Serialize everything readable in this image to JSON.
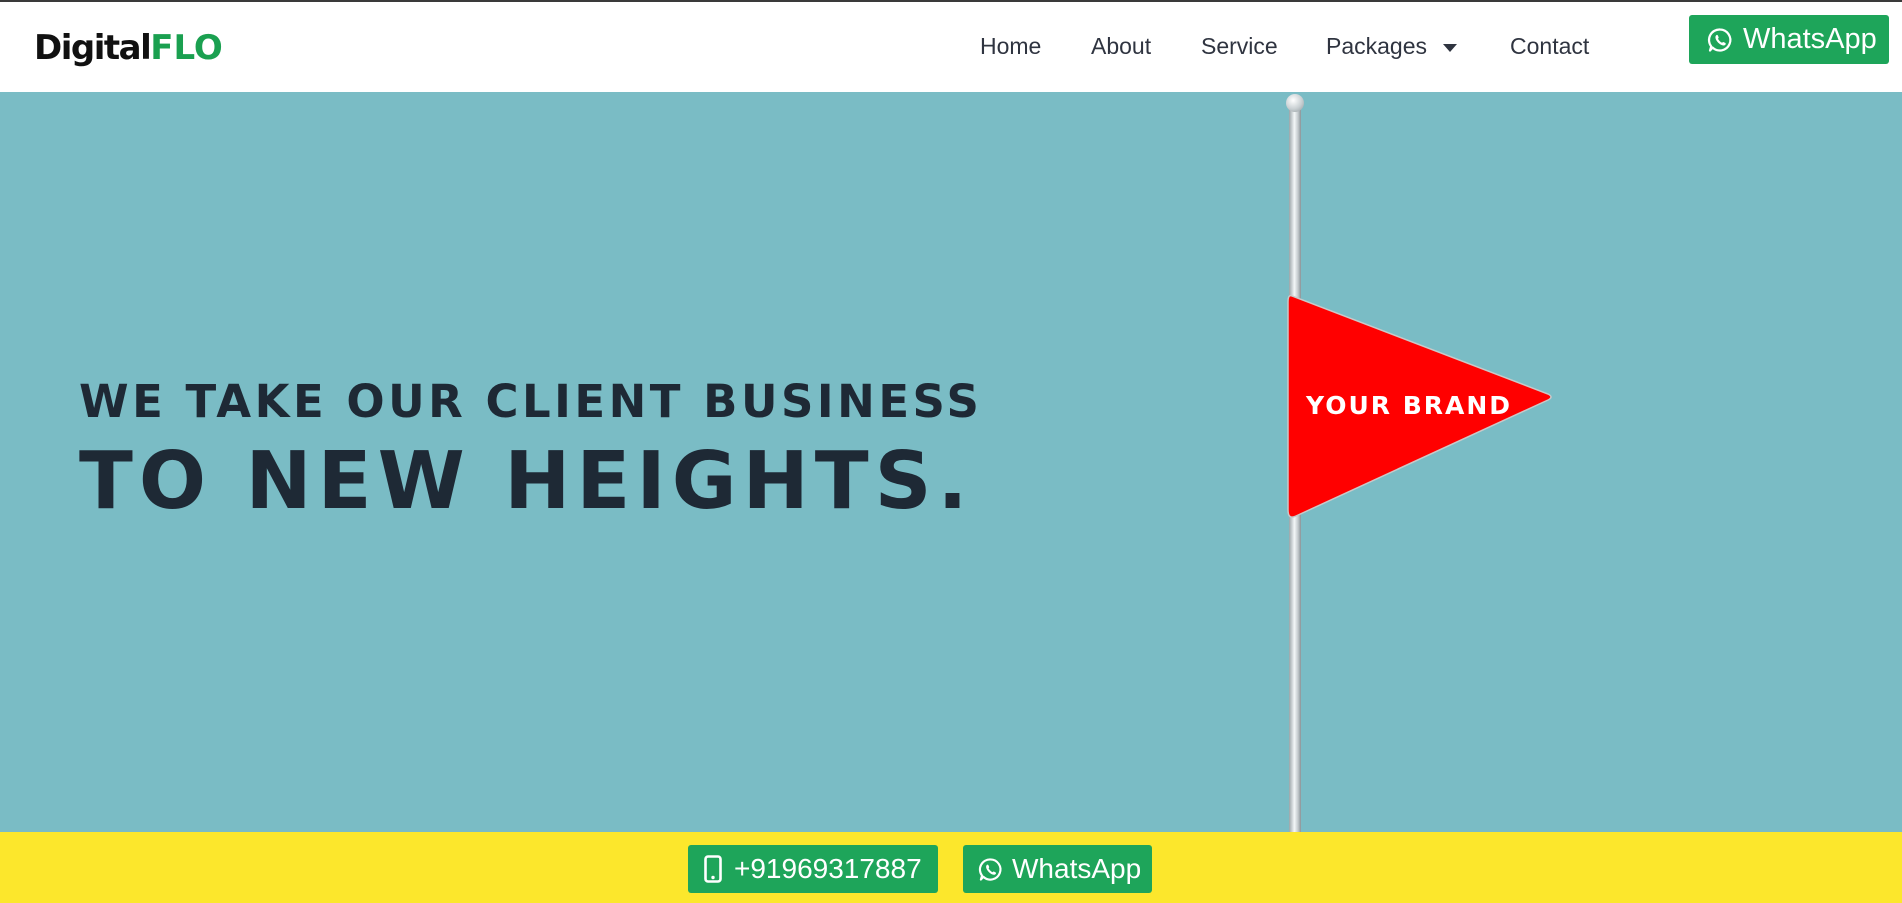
{
  "header": {
    "logo": {
      "part1": "Digital",
      "part2": "FLO"
    },
    "nav": [
      {
        "label": "Home"
      },
      {
        "label": "About"
      },
      {
        "label": "Service"
      },
      {
        "label": "Packages",
        "has_dropdown": true
      },
      {
        "label": "Contact"
      }
    ],
    "whatsapp_button": {
      "label": "WhatsApp",
      "icon": "whatsapp-icon"
    }
  },
  "hero": {
    "line1": "WE TAKE OUR CLIENT BUSINESS",
    "line2": "TO NEW HEIGHTS.",
    "flag_text": "YOUR BRAND"
  },
  "bottom_bar": {
    "phone_button": {
      "label": "+91969317887",
      "icon": "mobile-phone-icon"
    },
    "whatsapp_button": {
      "label": "WhatsApp",
      "icon": "whatsapp-icon"
    }
  },
  "colors": {
    "brand_green": "#1ea55a",
    "hero_background": "#7abcc5",
    "flag_red": "#ff0000",
    "bottom_bar_yellow": "#fce72c",
    "heading_dark": "#1e2935"
  }
}
